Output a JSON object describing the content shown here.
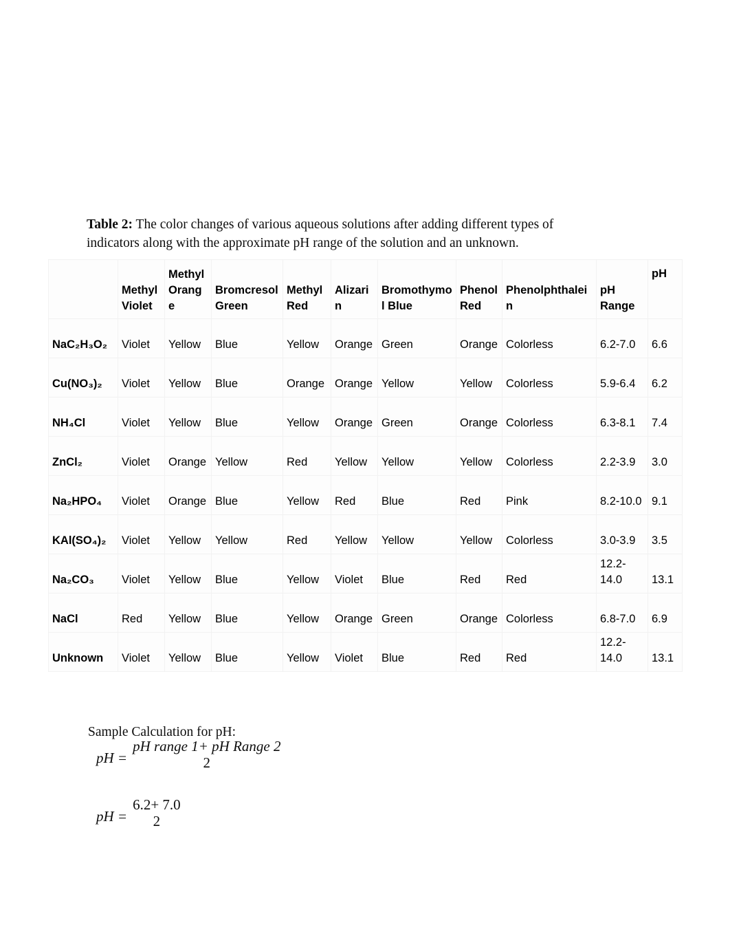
{
  "caption": {
    "label": "Table 2:",
    "text": " The color changes of various aqueous solutions after adding different types of indicators along with the approximate pH range of the solution and an unknown."
  },
  "table": {
    "headers": [
      "",
      "Methyl Violet",
      "Methyl Orange",
      "Bromcresol Green",
      "Methyl Red",
      "Alizarin",
      "Bromothymol Blue",
      "Phenol Red",
      "Phenolphthalein",
      "pH Range",
      "pH"
    ],
    "rows": [
      {
        "name": "NaC₂H₃O₂",
        "cells": [
          "Violet",
          "Yellow",
          "Blue",
          "Yellow",
          "Orange",
          "Green",
          "Orange",
          "Colorless",
          "6.2-7.0",
          "6.6"
        ]
      },
      {
        "name": "Cu(NO₃)₂",
        "cells": [
          "Violet",
          "Yellow",
          "Blue",
          "Orange",
          "Orange",
          "Yellow",
          "Yellow",
          "Colorless",
          "5.9-6.4",
          "6.2"
        ]
      },
      {
        "name": "NH₄Cl",
        "cells": [
          "Violet",
          "Yellow",
          "Blue",
          "Yellow",
          "Orange",
          "Green",
          "Orange",
          "Colorless",
          "6.3-8.1",
          "7.4"
        ]
      },
      {
        "name": "ZnCl₂",
        "cells": [
          "Violet",
          "Orange",
          "Yellow",
          "Red",
          "Yellow",
          "Yellow",
          "Yellow",
          "Colorless",
          "2.2-3.9",
          "3.0"
        ]
      },
      {
        "name": "Na₂HPO₄",
        "cells": [
          "Violet",
          "Orange",
          "Blue",
          "Yellow",
          "Red",
          "Blue",
          "Red",
          "Pink",
          "8.2-10.0",
          "9.1"
        ]
      },
      {
        "name": "KAl(SO₄)₂",
        "cells": [
          "Violet",
          "Yellow",
          "Yellow",
          "Red",
          "Yellow",
          "Yellow",
          "Yellow",
          "Colorless",
          "3.0-3.9",
          "3.5"
        ]
      },
      {
        "name": "Na₂CO₃",
        "cells": [
          "Violet",
          "Yellow",
          "Blue",
          "Yellow",
          "Violet",
          "Blue",
          "Red",
          "Red",
          "12.2-14.0",
          "13.1"
        ]
      },
      {
        "name": "NaCl",
        "cells": [
          "Red",
          "Yellow",
          "Blue",
          "Yellow",
          "Orange",
          "Green",
          "Orange",
          "Colorless",
          "6.8-7.0",
          "6.9"
        ]
      },
      {
        "name": "Unknown",
        "cells": [
          "Violet",
          "Yellow",
          "Blue",
          "Yellow",
          "Violet",
          "Blue",
          "Red",
          "Red",
          "12.2-14.0",
          "13.1"
        ]
      }
    ]
  },
  "calculation": {
    "label": "Sample Calculation for pH:",
    "equation_general": {
      "lhs": "pH =",
      "numerator": "pH range 1+ pH Range 2",
      "denominator": "2"
    },
    "equation_example": {
      "lhs": "pH =",
      "numerator": "6.2+ 7.0",
      "denominator": "2"
    }
  }
}
